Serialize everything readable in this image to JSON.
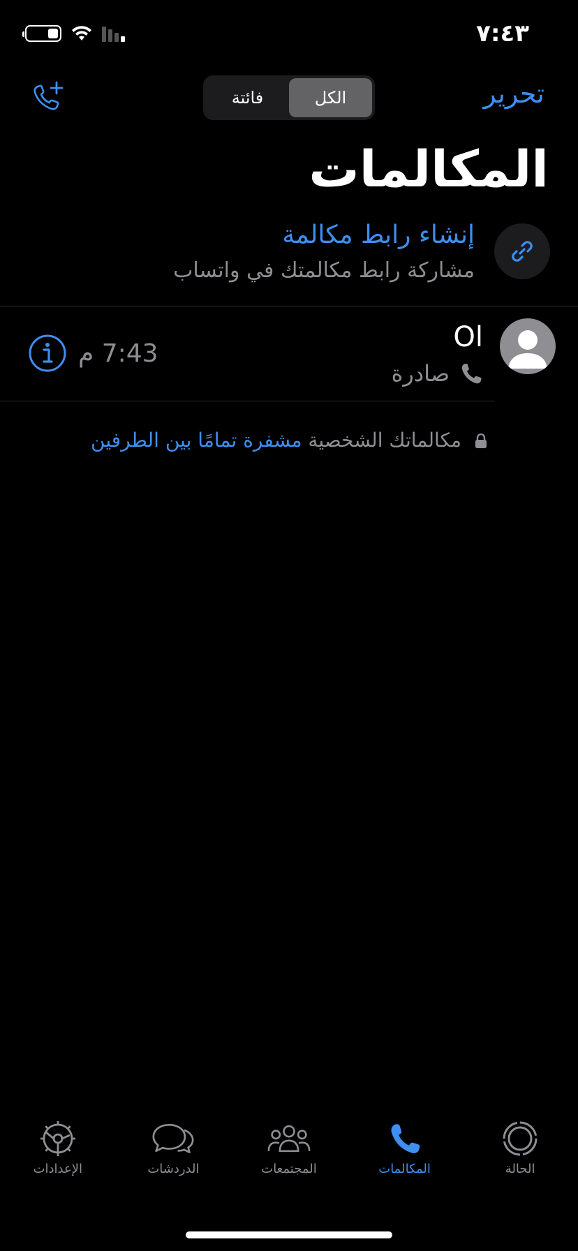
{
  "status_bar": {
    "time": "٧:٤٣"
  },
  "header": {
    "edit_label": "تحرير",
    "segments": [
      "الكل",
      "فائتة"
    ],
    "title": "المكالمات"
  },
  "create_link": {
    "title": "إنشاء رابط مكالمة",
    "subtitle": "مشاركة رابط مكالمتك في واتساب"
  },
  "calls": [
    {
      "name": "Ol",
      "type": "صادرة",
      "time": "7:43 م"
    }
  ],
  "encryption_note": {
    "prefix": "مكالماتك الشخصية",
    "link": "مشفرة تمامًا بين الطرفين"
  },
  "tabs": [
    {
      "label": "الحالة",
      "icon": "status-icon",
      "active": false
    },
    {
      "label": "المكالمات",
      "icon": "phone-icon",
      "active": true
    },
    {
      "label": "المجتمعات",
      "icon": "communities-icon",
      "active": false
    },
    {
      "label": "الدردشات",
      "icon": "chats-icon",
      "active": false
    },
    {
      "label": "الإعدادات",
      "icon": "settings-icon",
      "active": false
    }
  ],
  "colors": {
    "accent": "#3d8ff0",
    "secondary_text": "#8e8e93",
    "background": "#000000"
  }
}
